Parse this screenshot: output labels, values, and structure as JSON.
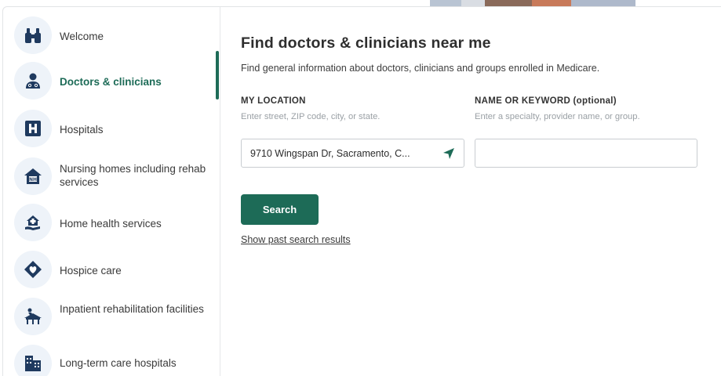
{
  "sidebar": {
    "items": [
      {
        "label": "Welcome",
        "icon": "binoculars-icon",
        "active": false
      },
      {
        "label": "Doctors & clinicians",
        "icon": "doctor-icon",
        "active": true
      },
      {
        "label": "Hospitals",
        "icon": "hospital-h-icon",
        "active": false
      },
      {
        "label": "Nursing homes including rehab services",
        "icon": "nursing-home-icon",
        "active": false
      },
      {
        "label": "Home health services",
        "icon": "home-health-icon",
        "active": false
      },
      {
        "label": "Hospice care",
        "icon": "hospice-heart-icon",
        "active": false
      },
      {
        "label": "Inpatient rehabilitation facilities",
        "icon": "rehab-facility-icon",
        "active": false
      },
      {
        "label": "Long-term care hospitals",
        "icon": "long-term-care-icon",
        "active": false
      }
    ]
  },
  "main": {
    "title": "Find doctors & clinicians near me",
    "subtitle": "Find general information about doctors, clinicians and groups enrolled in Medicare.",
    "location": {
      "label": "MY LOCATION",
      "hint": "Enter street, ZIP code, city, or state.",
      "value": "9710 Wingspan Dr, Sacramento, C..."
    },
    "keyword": {
      "label": "NAME OR KEYWORD (optional)",
      "hint": "Enter a specialty, provider name, or group.",
      "value": ""
    },
    "search_label": "Search",
    "past_results_label": "Show past search results"
  },
  "colors": {
    "accent": "#1d6b57",
    "icon_dark": "#1f3a5f",
    "icon_bg": "#eef3f9"
  }
}
